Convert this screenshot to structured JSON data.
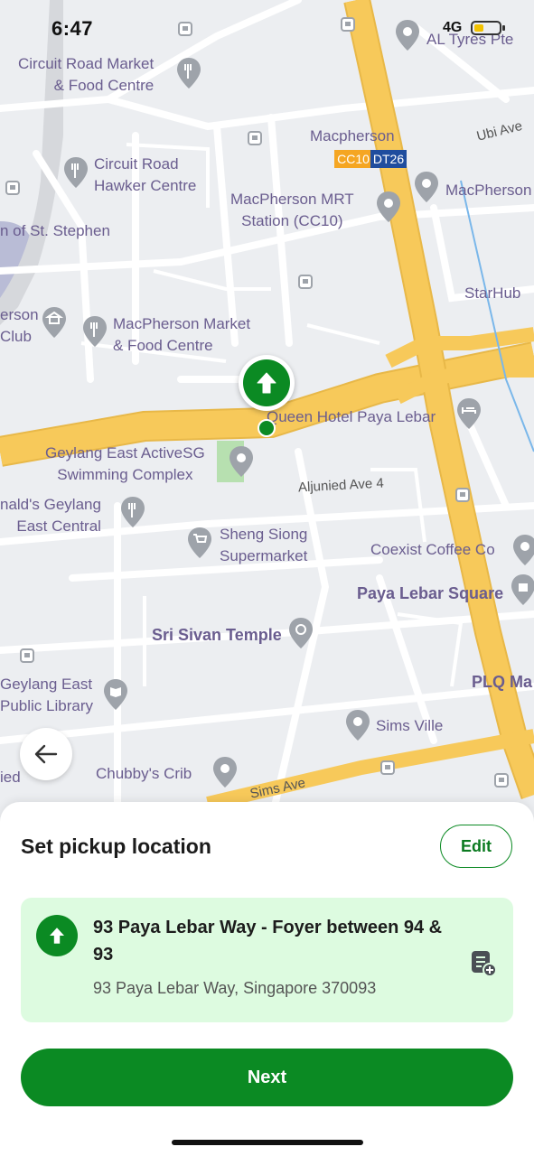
{
  "status_bar": {
    "time": "6:47",
    "network": "4G"
  },
  "map": {
    "labels": {
      "circuit_market": "Circuit Road Market\n& Food Centre",
      "circuit_hawker": "Circuit Road\nHawker Centre",
      "macpherson": "Macpherson",
      "cc10": "CC10",
      "dt26": "DT26",
      "ubi": "Ubi Ave",
      "al_tyres": "AL Tyres Pte",
      "macpherson_mrt": "MacPherson MRT\nStation (CC10)",
      "macpherson_right": "MacPherson",
      "st_stephen": "n of St. Stephen",
      "starhub": "StarHub",
      "erson_club": "erson\nClub",
      "macpherson_market": "MacPherson Market\n& Food Centre",
      "queen_hotel": "Queen Hotel Paya Lebar",
      "geylang_activesg": "Geylang East ActiveSG\nSwimming Complex",
      "aljunied_ave4": "Aljunied Ave 4",
      "mcdonalds": "nald's Geylang\nEast Central",
      "sheng_siong": "Sheng Siong\nSupermarket",
      "coexist": "Coexist Coffee Co",
      "paya_lebar_square": "Paya Lebar Square",
      "sri_sivan": "Sri Sivan Temple",
      "geylang_library": "Geylang East\nPublic Library",
      "plq": "PLQ Ma",
      "sims_ville": "Sims Ville",
      "chubbys": "Chubby's Crib",
      "sims_ave": "Sims Ave",
      "ied": "ied"
    }
  },
  "sheet": {
    "title": "Set pickup location",
    "edit_label": "Edit",
    "location_name": "93 Paya Lebar Way - Foyer between 94 & 93",
    "location_address": "93 Paya Lebar Way, Singapore 370093",
    "next_label": "Next"
  },
  "colors": {
    "brand_green": "#0b8a23",
    "card_bg": "#ddfbe0",
    "road_major": "#f7c95a",
    "map_bg": "#eceef1",
    "label_purple": "#6a5d8f",
    "mrt_orange": "#f5a623",
    "mrt_blue": "#1f4d9e"
  },
  "icons": {
    "back": "arrow-left-icon",
    "pin": "arrow-up-icon",
    "note": "note-add-icon"
  }
}
